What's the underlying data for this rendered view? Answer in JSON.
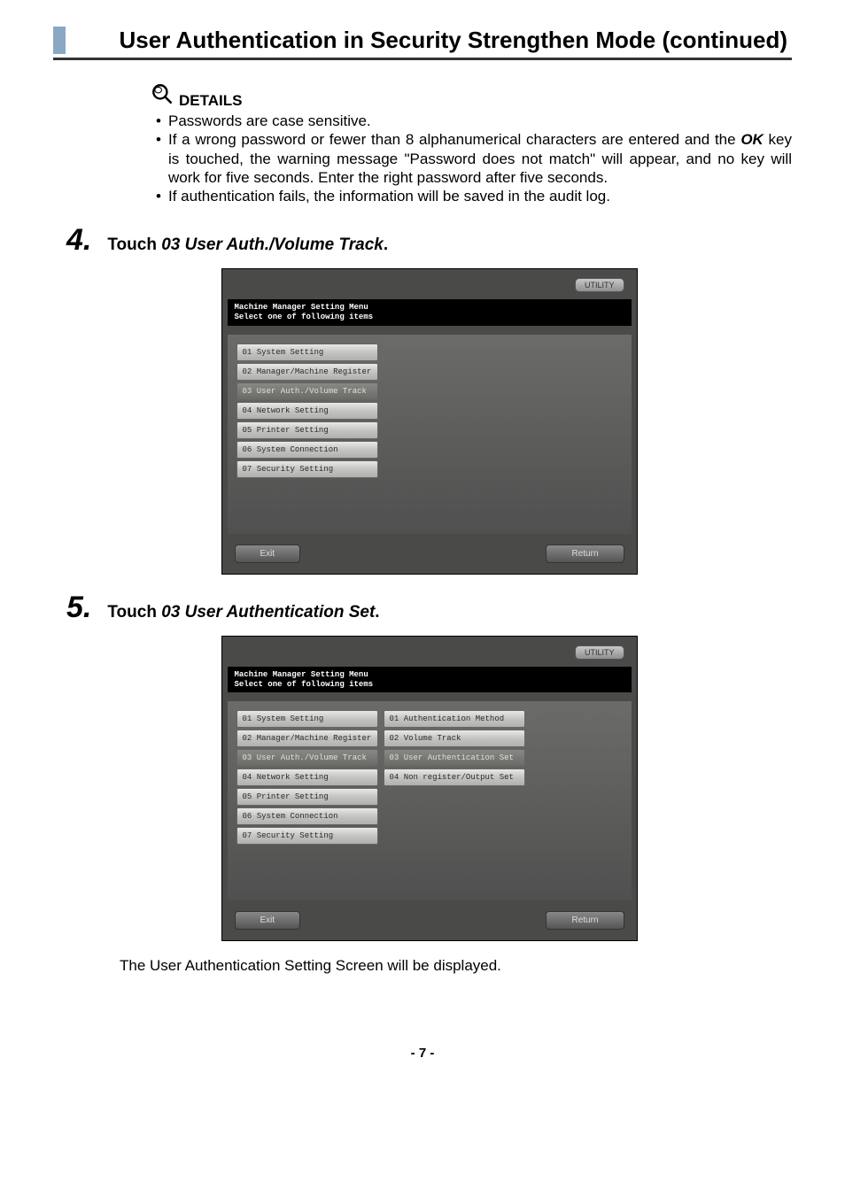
{
  "header": {
    "title": "User Authentication in Security Strengthen Mode (continued)"
  },
  "details": {
    "label": "DETAILS",
    "bullets": {
      "b1": "Passwords are case sensitive.",
      "b2a": "If a wrong password or fewer than 8 alphanumerical characters are entered and the ",
      "b2_ok": "OK",
      "b2b": " key is touched, the warning message \"Password does not match\" will appear, and no key will work for five seconds. Enter the right password after five seconds.",
      "b3": "If authentication fails, the information will be saved in the audit log."
    }
  },
  "step4": {
    "number": "4.",
    "text_prefix": "Touch ",
    "text_italic": "03 User Auth./Volume Track",
    "text_suffix": "."
  },
  "step5": {
    "number": "5.",
    "text_prefix": "Touch ",
    "text_italic": "03 User Authentication Set",
    "text_suffix": "."
  },
  "screen_common": {
    "top_button": "UTILITY",
    "header_l1": "Machine Manager Setting Menu",
    "header_l2": "Select one of following items",
    "footer_exit": "Exit",
    "footer_return": "Return"
  },
  "screen1": {
    "left": {
      "i1": "01 System Setting",
      "i2": "02 Manager/Machine Register",
      "i3": "03 User Auth./Volume Track",
      "i4": "04 Network Setting",
      "i5": "05 Printer Setting",
      "i6": "06 System Connection",
      "i7": "07 Security Setting"
    }
  },
  "screen2": {
    "left": {
      "i1": "01 System Setting",
      "i2": "02 Manager/Machine Register",
      "i3": "03 User Auth./Volume Track",
      "i4": "04 Network Setting",
      "i5": "05 Printer Setting",
      "i6": "06 System Connection",
      "i7": "07 Security Setting"
    },
    "right": {
      "i1": "01 Authentication Method",
      "i2": "02 Volume Track",
      "i3": "03 User Authentication Set",
      "i4": "04 Non register/Output Set"
    }
  },
  "closing": "The User Authentication Setting Screen will be displayed.",
  "page_number": "- 7 -"
}
